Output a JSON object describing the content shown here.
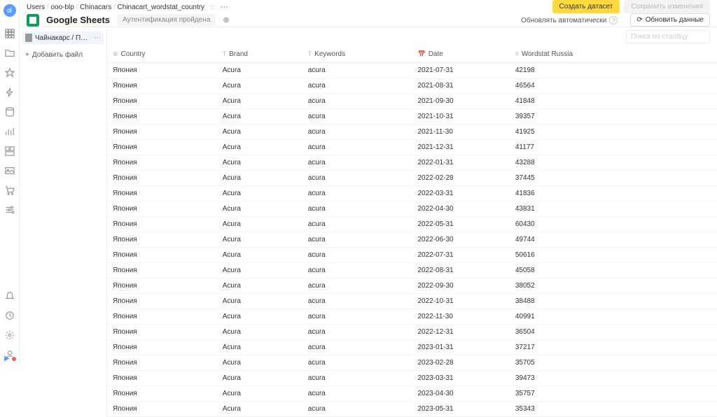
{
  "breadcrumb": [
    "Users",
    "ooo-blp",
    "Chinacars",
    "Chinacart_wordstat_country"
  ],
  "buttons": {
    "create_dataset": "Создать датасет",
    "save_changes": "Сохранить изменения",
    "auto_refresh": "Обновлять автоматически",
    "refresh_data": "Обновить данные"
  },
  "source": {
    "title": "Google Sheets",
    "auth_status": "Аутентификация пройдена"
  },
  "sidebar": {
    "file_name": "Чайнакарс / Популярность...",
    "add_file": "Добавить файл"
  },
  "search": {
    "placeholder": "Поиск по столбцу"
  },
  "columns": [
    "Country",
    "Brand",
    "Keywords",
    "Date",
    "Wordstat Russia"
  ],
  "column_icons": [
    "⊕",
    "T",
    "T",
    "📅",
    "#"
  ],
  "rows": [
    {
      "country": "Япония",
      "brand": "Acura",
      "keywords": "acura",
      "date": "2021-07-31",
      "wordstat": "42198"
    },
    {
      "country": "Япония",
      "brand": "Acura",
      "keywords": "acura",
      "date": "2021-08-31",
      "wordstat": "46564"
    },
    {
      "country": "Япония",
      "brand": "Acura",
      "keywords": "acura",
      "date": "2021-09-30",
      "wordstat": "41848"
    },
    {
      "country": "Япония",
      "brand": "Acura",
      "keywords": "acura",
      "date": "2021-10-31",
      "wordstat": "39357"
    },
    {
      "country": "Япония",
      "brand": "Acura",
      "keywords": "acura",
      "date": "2021-11-30",
      "wordstat": "41925"
    },
    {
      "country": "Япония",
      "brand": "Acura",
      "keywords": "acura",
      "date": "2021-12-31",
      "wordstat": "41177"
    },
    {
      "country": "Япония",
      "brand": "Acura",
      "keywords": "acura",
      "date": "2022-01-31",
      "wordstat": "43288"
    },
    {
      "country": "Япония",
      "brand": "Acura",
      "keywords": "acura",
      "date": "2022-02-28",
      "wordstat": "37445"
    },
    {
      "country": "Япония",
      "brand": "Acura",
      "keywords": "acura",
      "date": "2022-03-31",
      "wordstat": "41836"
    },
    {
      "country": "Япония",
      "brand": "Acura",
      "keywords": "acura",
      "date": "2022-04-30",
      "wordstat": "43831"
    },
    {
      "country": "Япония",
      "brand": "Acura",
      "keywords": "acura",
      "date": "2022-05-31",
      "wordstat": "60430"
    },
    {
      "country": "Япония",
      "brand": "Acura",
      "keywords": "acura",
      "date": "2022-06-30",
      "wordstat": "49744"
    },
    {
      "country": "Япония",
      "brand": "Acura",
      "keywords": "acura",
      "date": "2022-07-31",
      "wordstat": "50616"
    },
    {
      "country": "Япония",
      "brand": "Acura",
      "keywords": "acura",
      "date": "2022-08-31",
      "wordstat": "45058"
    },
    {
      "country": "Япония",
      "brand": "Acura",
      "keywords": "acura",
      "date": "2022-09-30",
      "wordstat": "38052"
    },
    {
      "country": "Япония",
      "brand": "Acura",
      "keywords": "acura",
      "date": "2022-10-31",
      "wordstat": "38488"
    },
    {
      "country": "Япония",
      "brand": "Acura",
      "keywords": "acura",
      "date": "2022-11-30",
      "wordstat": "40991"
    },
    {
      "country": "Япония",
      "brand": "Acura",
      "keywords": "acura",
      "date": "2022-12-31",
      "wordstat": "36504"
    },
    {
      "country": "Япония",
      "brand": "Acura",
      "keywords": "acura",
      "date": "2023-01-31",
      "wordstat": "37217"
    },
    {
      "country": "Япония",
      "brand": "Acura",
      "keywords": "acura",
      "date": "2023-02-28",
      "wordstat": "35705"
    },
    {
      "country": "Япония",
      "brand": "Acura",
      "keywords": "acura",
      "date": "2023-03-31",
      "wordstat": "39473"
    },
    {
      "country": "Япония",
      "brand": "Acura",
      "keywords": "acura",
      "date": "2023-04-30",
      "wordstat": "35757"
    },
    {
      "country": "Япония",
      "brand": "Acura",
      "keywords": "acura",
      "date": "2023-05-31",
      "wordstat": "35343"
    }
  ]
}
